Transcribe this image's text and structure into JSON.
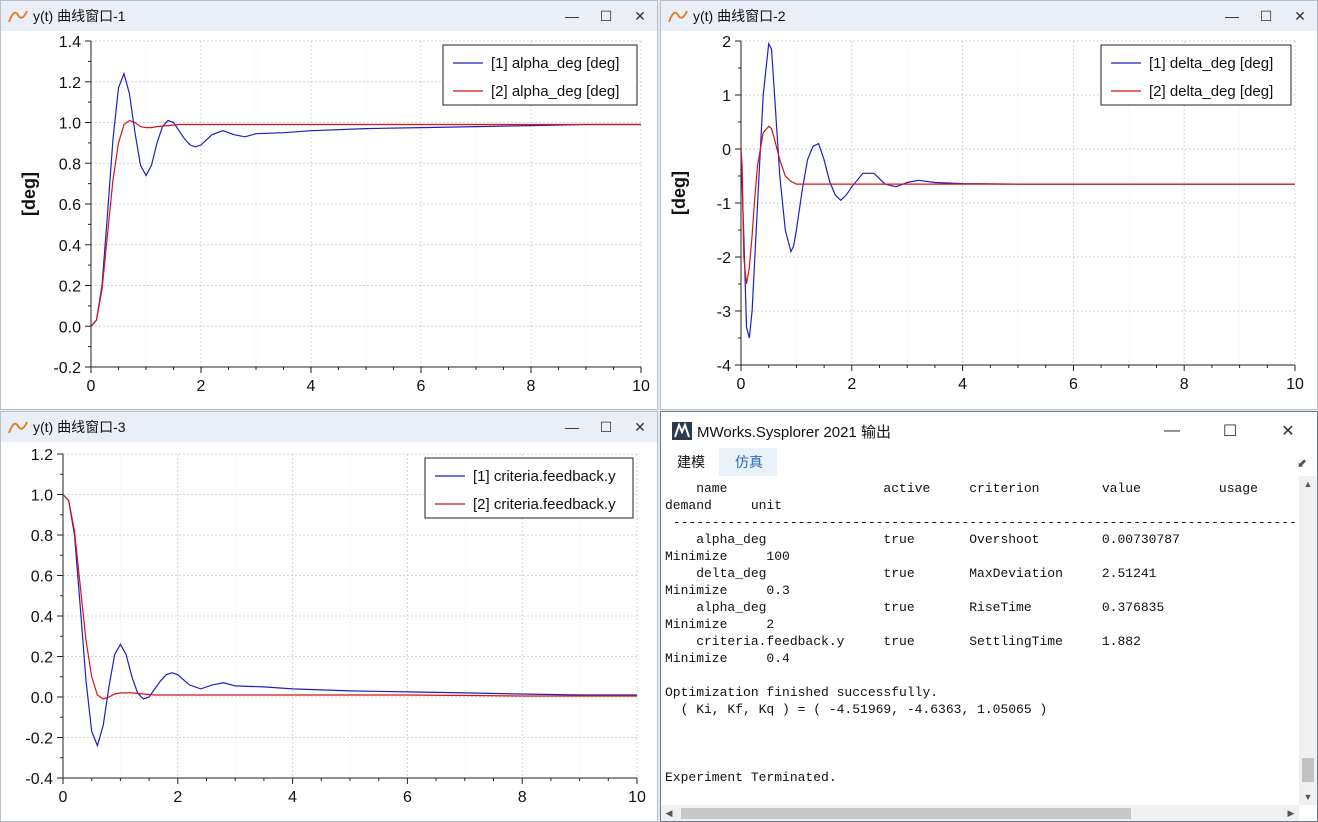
{
  "windows": [
    {
      "id": "win1",
      "title": "y(t) 曲线窗口-1",
      "ylabel": "[deg]",
      "legend": [
        "[1] alpha_deg [deg]",
        "[2] alpha_deg [deg]"
      ]
    },
    {
      "id": "win2",
      "title": "y(t) 曲线窗口-2",
      "ylabel": "[deg]",
      "legend": [
        "[1] delta_deg [deg]",
        "[2] delta_deg [deg]"
      ]
    },
    {
      "id": "win3",
      "title": "y(t) 曲线窗口-3",
      "ylabel": "",
      "legend": [
        "[1] criteria.feedback.y",
        "[2] criteria.feedback.y"
      ]
    }
  ],
  "window_buttons": {
    "minimize": "—",
    "maximize": "☐",
    "close": "✕"
  },
  "output": {
    "title": "MWorks.Sysplorer 2021 输出",
    "tabs": [
      "建模",
      "仿真"
    ],
    "active_tab": "仿真",
    "lines": [
      "    name                    active     criterion        value          usage",
      "demand     unit",
      " -------------------------------------------------------------------------------------------",
      "    alpha_deg               true       Overshoot        0.00730787",
      "Minimize     100",
      "    delta_deg               true       MaxDeviation     2.51241",
      "Minimize     0.3",
      "    alpha_deg               true       RiseTime         0.376835",
      "Minimize     2",
      "    criteria.feedback.y     true       SettlingTime     1.882",
      "Minimize     0.4",
      "",
      "Optimization finished successfully.",
      "  ( Ki, Kf, Kq ) = ( -4.51969, -4.6363, 1.05065 )",
      "",
      "",
      "",
      "Experiment Terminated."
    ]
  },
  "colors": {
    "series1": "#1f1fbf",
    "series2": "#d41515",
    "grid": "#d4d4d4",
    "titlebar": "#eaeff7"
  },
  "chart_data": [
    {
      "type": "line",
      "xlim": [
        0,
        10
      ],
      "ylim": [
        -0.2,
        1.4
      ],
      "xticks": [
        0,
        2,
        4,
        6,
        8,
        10
      ],
      "yticks": [
        -0.2,
        0.0,
        0.2,
        0.4,
        0.6,
        0.8,
        1.0,
        1.2,
        1.4
      ],
      "ytick_labels": [
        "-0.2",
        "0.0",
        "0.2",
        "0.4",
        "0.6",
        "0.8",
        "1.0",
        "1.2",
        "1.4"
      ],
      "ylabel": "[deg]",
      "grid": true,
      "legend_position": "top-right",
      "series": [
        {
          "name": "[1] alpha_deg [deg]",
          "color": "#1f1fbf",
          "x": [
            0,
            0.1,
            0.2,
            0.3,
            0.4,
            0.5,
            0.6,
            0.7,
            0.8,
            0.9,
            1.0,
            1.1,
            1.2,
            1.3,
            1.4,
            1.5,
            1.6,
            1.7,
            1.8,
            1.9,
            2.0,
            2.2,
            2.4,
            2.6,
            2.8,
            3.0,
            3.5,
            4.0,
            5.0,
            6.0,
            7.0,
            8.0,
            9.0,
            10.0
          ],
          "y": [
            0,
            0.03,
            0.2,
            0.55,
            0.92,
            1.17,
            1.24,
            1.14,
            0.95,
            0.79,
            0.74,
            0.79,
            0.9,
            0.98,
            1.01,
            1.0,
            0.96,
            0.92,
            0.89,
            0.88,
            0.89,
            0.94,
            0.96,
            0.94,
            0.93,
            0.945,
            0.95,
            0.96,
            0.97,
            0.975,
            0.98,
            0.985,
            0.99,
            0.99
          ]
        },
        {
          "name": "[2] alpha_deg [deg]",
          "color": "#d41515",
          "x": [
            0,
            0.1,
            0.2,
            0.3,
            0.4,
            0.5,
            0.6,
            0.7,
            0.8,
            0.9,
            1.0,
            1.1,
            1.2,
            1.4,
            1.6,
            2.0,
            3.0,
            4.0,
            6.0,
            8.0,
            10.0
          ],
          "y": [
            0,
            0.03,
            0.18,
            0.45,
            0.72,
            0.9,
            0.99,
            1.01,
            1.0,
            0.98,
            0.975,
            0.975,
            0.98,
            0.985,
            0.99,
            0.99,
            0.99,
            0.99,
            0.99,
            0.99,
            0.99
          ]
        }
      ]
    },
    {
      "type": "line",
      "xlim": [
        0,
        10
      ],
      "ylim": [
        -4,
        2
      ],
      "xticks": [
        0,
        2,
        4,
        6,
        8,
        10
      ],
      "yticks": [
        -4,
        -3,
        -2,
        -1,
        0,
        1,
        2
      ],
      "ytick_labels": [
        "-4",
        "-3",
        "-2",
        "-1",
        "0",
        "1",
        "2"
      ],
      "ylabel": "[deg]",
      "grid": true,
      "legend_position": "top-right",
      "series": [
        {
          "name": "[1] delta_deg [deg]",
          "color": "#1f1fbf",
          "x": [
            0,
            0.05,
            0.1,
            0.15,
            0.2,
            0.3,
            0.4,
            0.5,
            0.55,
            0.6,
            0.7,
            0.8,
            0.9,
            0.95,
            1.0,
            1.1,
            1.2,
            1.3,
            1.4,
            1.5,
            1.6,
            1.7,
            1.8,
            1.9,
            2.0,
            2.2,
            2.4,
            2.6,
            2.8,
            3.0,
            3.2,
            3.5,
            4.0,
            5.0,
            6.0,
            8.0,
            10.0
          ],
          "y": [
            0,
            -1.6,
            -3.3,
            -3.5,
            -3.0,
            -1.0,
            1.0,
            1.95,
            1.85,
            1.1,
            -0.5,
            -1.5,
            -1.9,
            -1.8,
            -1.5,
            -0.8,
            -0.2,
            0.05,
            0.1,
            -0.2,
            -0.6,
            -0.85,
            -0.95,
            -0.85,
            -0.7,
            -0.45,
            -0.45,
            -0.65,
            -0.7,
            -0.62,
            -0.58,
            -0.62,
            -0.64,
            -0.65,
            -0.65,
            -0.65,
            -0.65
          ]
        },
        {
          "name": "[2] delta_deg [deg]",
          "color": "#d41515",
          "x": [
            0,
            0.02,
            0.05,
            0.1,
            0.15,
            0.2,
            0.25,
            0.3,
            0.4,
            0.5,
            0.55,
            0.6,
            0.7,
            0.8,
            0.9,
            1.0,
            1.2,
            1.5,
            2.0,
            3.0,
            5.0,
            8.0,
            10.0
          ],
          "y": [
            0,
            -0.3,
            -2.0,
            -2.5,
            -2.2,
            -1.6,
            -0.9,
            -0.3,
            0.3,
            0.42,
            0.38,
            0.2,
            -0.2,
            -0.5,
            -0.6,
            -0.65,
            -0.65,
            -0.65,
            -0.65,
            -0.65,
            -0.65,
            -0.65,
            -0.65
          ]
        }
      ]
    },
    {
      "type": "line",
      "xlim": [
        0,
        10
      ],
      "ylim": [
        -0.4,
        1.2
      ],
      "xticks": [
        0,
        2,
        4,
        6,
        8,
        10
      ],
      "yticks": [
        -0.4,
        -0.2,
        0.0,
        0.2,
        0.4,
        0.6,
        0.8,
        1.0,
        1.2
      ],
      "ytick_labels": [
        "-0.4",
        "-0.2",
        "0.0",
        "0.2",
        "0.4",
        "0.6",
        "0.8",
        "1.0",
        "1.2"
      ],
      "ylabel": "",
      "grid": true,
      "legend_position": "top-right",
      "series": [
        {
          "name": "[1] criteria.feedback.y",
          "color": "#1f1fbf",
          "x": [
            0,
            0.1,
            0.2,
            0.3,
            0.4,
            0.5,
            0.6,
            0.7,
            0.8,
            0.9,
            1.0,
            1.1,
            1.2,
            1.3,
            1.4,
            1.5,
            1.6,
            1.7,
            1.8,
            1.9,
            2.0,
            2.2,
            2.4,
            2.6,
            2.8,
            3.0,
            3.5,
            4.0,
            5.0,
            6.0,
            7.0,
            8.0,
            9.0,
            10.0
          ],
          "y": [
            1.0,
            0.97,
            0.8,
            0.45,
            0.08,
            -0.17,
            -0.24,
            -0.14,
            0.05,
            0.21,
            0.26,
            0.21,
            0.1,
            0.02,
            -0.01,
            0.0,
            0.04,
            0.08,
            0.11,
            0.12,
            0.11,
            0.06,
            0.04,
            0.06,
            0.07,
            0.055,
            0.05,
            0.04,
            0.03,
            0.025,
            0.02,
            0.015,
            0.01,
            0.01
          ]
        },
        {
          "name": "[2] criteria.feedback.y",
          "color": "#d41515",
          "x": [
            0,
            0.1,
            0.2,
            0.3,
            0.4,
            0.5,
            0.6,
            0.7,
            0.8,
            0.9,
            1.0,
            1.2,
            1.4,
            1.6,
            2.0,
            3.0,
            4.0,
            6.0,
            8.0,
            10.0
          ],
          "y": [
            1.0,
            0.97,
            0.82,
            0.55,
            0.28,
            0.1,
            0.01,
            -0.01,
            0.0,
            0.015,
            0.02,
            0.02,
            0.015,
            0.01,
            0.01,
            0.01,
            0.01,
            0.01,
            0.005,
            0.005
          ]
        }
      ]
    }
  ]
}
